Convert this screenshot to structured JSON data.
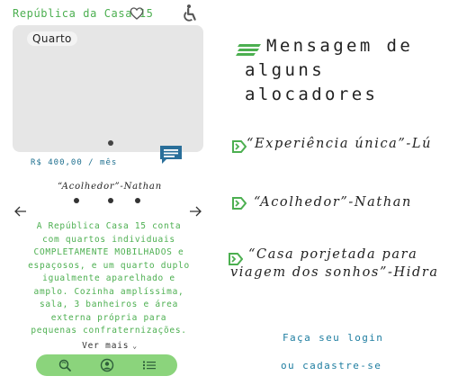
{
  "listing": {
    "title": "República da Casa 15",
    "photo_label": "Quarto",
    "price": "R$ 400,00 / mês",
    "owner_quote": "“Acolhedor”-Nathan",
    "description": "A República Casa 15 conta com quartos individuais COMPLETAMENTE MOBILHADOS e espaçosos, e um quarto duplo igualmente aparelhado e amplo. Cozinha amplíssima, sala, 3 banheiros e área externa própria para pequenas confraternizações.",
    "see_more": "Ver mais"
  },
  "icons": {
    "favorite": "heart-outline-icon",
    "accessibility": "accessibility-icon",
    "chat": "chat-bubble-icon",
    "prev": "arrow-left-icon",
    "next": "arrow-right-icon",
    "heading": "stack-lines-icon",
    "review": "tag-arrow-icon"
  },
  "nav": {
    "items": [
      {
        "name": "search",
        "icon": "search-refresh-icon"
      },
      {
        "name": "profile",
        "icon": "user-circle-icon"
      },
      {
        "name": "list",
        "icon": "list-icon"
      }
    ]
  },
  "reviews_section": {
    "heading_line1": "Mensagem de",
    "heading_line2": "alguns alocadores",
    "reviews": [
      {
        "text": "“Experiência única”-Lú"
      },
      {
        "text": "“Acolhedor”-Nathan"
      },
      {
        "text_line1": "“Casa porjetada para",
        "text_line2": "viagem dos sonhos”-Hidra"
      }
    ]
  },
  "auth": {
    "login": "Faça seu login",
    "signup": "ou cadastre-se"
  },
  "colors": {
    "green": "#4caf50",
    "nav_green": "#8bd47c",
    "link_blue": "#1e7da0",
    "chat_blue": "#2a6f9a"
  }
}
